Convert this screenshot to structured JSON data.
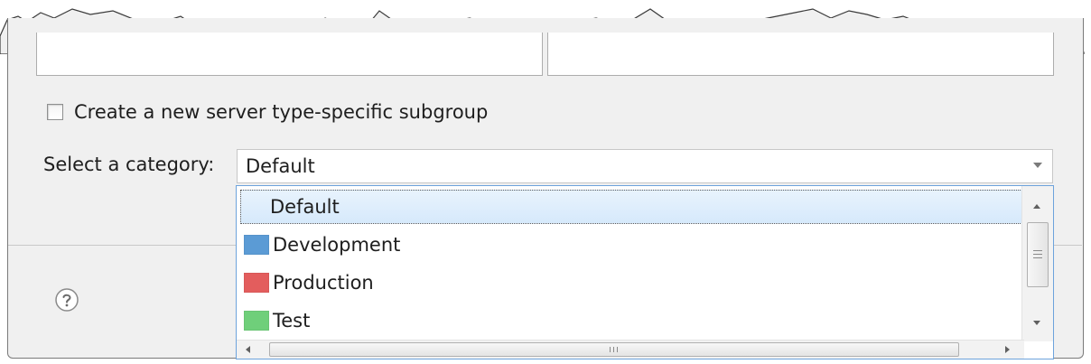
{
  "checkbox": {
    "label": "Create a new server type-specific subgroup",
    "checked": false
  },
  "category": {
    "label": "Select a category:",
    "selected_value": "Default",
    "options": [
      {
        "label": "Default",
        "color": null,
        "highlighted": true
      },
      {
        "label": "Development",
        "color": "#5b9bd5"
      },
      {
        "label": "Production",
        "color": "#e35d5d"
      },
      {
        "label": "Test",
        "color": "#6fcf7a"
      }
    ]
  },
  "icons": {
    "help": "help-icon",
    "dropdown_arrow": "chevron-down-icon"
  }
}
